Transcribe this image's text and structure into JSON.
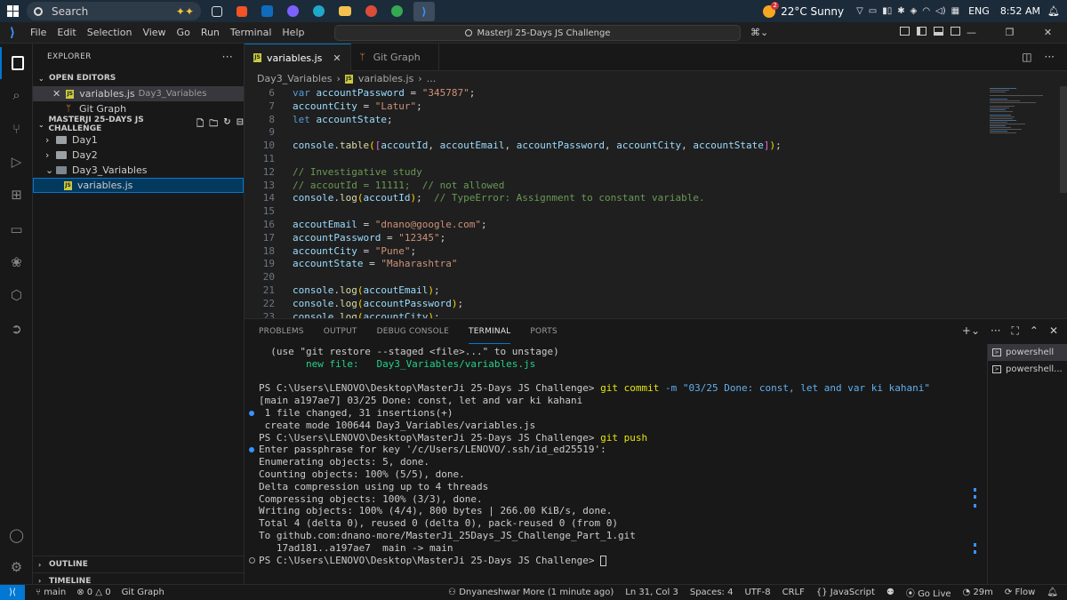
{
  "taskbar": {
    "search_placeholder": "Search",
    "weather_badge": "2",
    "weather": "22°C  Sunny",
    "language": "ENG",
    "time": "8:52 AM",
    "apps": [
      "widgets-app",
      "store-app",
      "outlook-app",
      "copilot-app",
      "edge-app",
      "explorer-app",
      "chrome-app",
      "chrome-app-2",
      "vscode-app"
    ]
  },
  "titlebar": {
    "menu": [
      "File",
      "Edit",
      "Selection",
      "View",
      "Go",
      "Run",
      "Terminal",
      "Help"
    ],
    "command_center": "MasterJi 25-Days JS Challenge"
  },
  "sidebar": {
    "title": "EXPLORER",
    "open_editors_label": "OPEN EDITORS",
    "open_editors": [
      {
        "name": "variables.js",
        "desc": "Day3_Variables",
        "type": "js"
      },
      {
        "name": "Git Graph",
        "desc": "",
        "type": "gitgraph"
      }
    ],
    "workspace_label": "MASTERJI 25-DAYS JS CHALLENGE",
    "tree": [
      {
        "name": "Day1",
        "chevron": "›"
      },
      {
        "name": "Day2",
        "chevron": "›"
      },
      {
        "name": "Day3_Variables",
        "chevron": "⌄"
      },
      {
        "name": "variables.js"
      }
    ],
    "outline_label": "OUTLINE",
    "timeline_label": "TIMELINE"
  },
  "tabs": [
    {
      "label": "variables.js",
      "active": true
    },
    {
      "label": "Git Graph",
      "active": false
    }
  ],
  "breadcrumb": {
    "folder": "Day3_Variables",
    "file": "variables.js",
    "more": "..."
  },
  "editor": {
    "lines": [
      {
        "n": "6",
        "code": "var accountPassword = \"345787\";"
      },
      {
        "n": "7",
        "code": "accountCity = \"Latur\";"
      },
      {
        "n": "8",
        "code": "let accountState;"
      },
      {
        "n": "9",
        "code": ""
      },
      {
        "n": "10",
        "code": "console.table([accoutId, accoutEmail, accountPassword, accountCity, accountState]);"
      },
      {
        "n": "11",
        "code": ""
      },
      {
        "n": "12",
        "code": "// Investigative study"
      },
      {
        "n": "13",
        "code": "// accoutId = 11111;  // not allowed"
      },
      {
        "n": "14",
        "code": "console.log(accoutId);  // TypeError: Assignment to constant variable."
      },
      {
        "n": "15",
        "code": ""
      },
      {
        "n": "16",
        "code": "accoutEmail = \"dnano@google.com\";"
      },
      {
        "n": "17",
        "code": "accountPassword = \"12345\";"
      },
      {
        "n": "18",
        "code": "accountCity = \"Pune\";"
      },
      {
        "n": "19",
        "code": "accountState = \"Maharashtra\""
      },
      {
        "n": "20",
        "code": ""
      },
      {
        "n": "21",
        "code": "console.log(accoutEmail);"
      },
      {
        "n": "22",
        "code": "console.log(accountPassword);"
      },
      {
        "n": "23",
        "code": "console.log(accountCity);"
      }
    ]
  },
  "panel": {
    "tabs": [
      "PROBLEMS",
      "OUTPUT",
      "DEBUG CONSOLE",
      "TERMINAL",
      "PORTS"
    ],
    "active_tab": "TERMINAL",
    "terminals": [
      "powershell",
      "powershell..."
    ],
    "terminal_lines": [
      {
        "t": "  (use \"git restore --staged <file>...\" to unstage)",
        "mark": ""
      },
      {
        "t": "        new file:   Day3_Variables/variables.js",
        "mark": "",
        "color": "green"
      },
      {
        "t": "",
        "mark": ""
      },
      {
        "t": "PS C:\\Users\\LENOVO\\Desktop\\MasterJi 25-Days JS Challenge> ",
        "cmd": "git commit",
        "arg": " -m \"03/25 Done: const, let and var ki kahani\"",
        "mark": ""
      },
      {
        "t": "[main a197ae7] 03/25 Done: const, let and var ki kahani",
        "mark": ""
      },
      {
        "t": " 1 file changed, 31 insertions(+)",
        "mark": "dot"
      },
      {
        "t": " create mode 100644 Day3_Variables/variables.js",
        "mark": ""
      },
      {
        "t": "PS C:\\Users\\LENOVO\\Desktop\\MasterJi 25-Days JS Challenge> ",
        "cmd": "git push",
        "arg": "",
        "mark": ""
      },
      {
        "t": "Enter passphrase for key '/c/Users/LENOVO/.ssh/id_ed25519':",
        "mark": "dot"
      },
      {
        "t": "Enumerating objects: 5, done.",
        "mark": ""
      },
      {
        "t": "Counting objects: 100% (5/5), done.",
        "mark": ""
      },
      {
        "t": "Delta compression using up to 4 threads",
        "mark": ""
      },
      {
        "t": "Compressing objects: 100% (3/3), done.",
        "mark": ""
      },
      {
        "t": "Writing objects: 100% (4/4), 800 bytes | 266.00 KiB/s, done.",
        "mark": ""
      },
      {
        "t": "Total 4 (delta 0), reused 0 (delta 0), pack-reused 0 (from 0)",
        "mark": ""
      },
      {
        "t": "To github.com:dnano-more/MasterJi_25Days_JS_Challenge_Part_1.git",
        "mark": ""
      },
      {
        "t": "   17ad181..a197ae7  main -> main",
        "mark": ""
      },
      {
        "t": "PS C:\\Users\\LENOVO\\Desktop\\MasterJi 25-Days JS Challenge> ",
        "cursor": true,
        "mark": "ring"
      }
    ]
  },
  "statusbar": {
    "branch": "main",
    "errors": "0",
    "warnings": "0",
    "git_graph": "Git Graph",
    "blame": "Dnyaneshwar More (1 minute ago)",
    "position": "Ln 31, Col 3",
    "spaces": "Spaces: 4",
    "encoding": "UTF-8",
    "eol": "CRLF",
    "language": "{} JavaScript",
    "golive": "Go Live",
    "timer": "29m",
    "flow": "Flow"
  },
  "colors": {
    "accent": "#0078d4",
    "js_badge": "#cbcb41",
    "keyword": "#569cd6",
    "string": "#ce9178",
    "comment": "#6a9955"
  }
}
